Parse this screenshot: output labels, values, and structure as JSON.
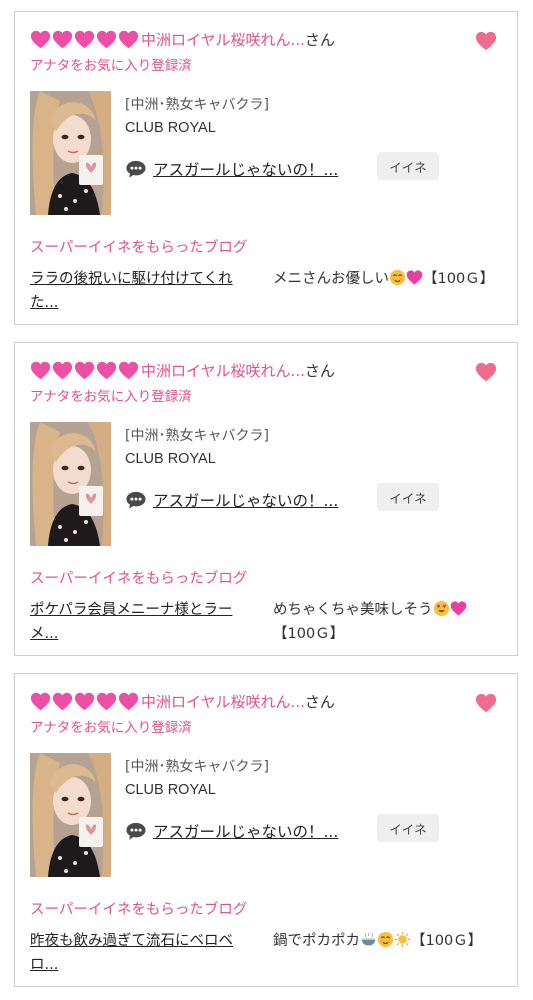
{
  "colors": {
    "accent": "#e2518f",
    "heart": "#ee4fa6",
    "fav_heart": "#f06b8e"
  },
  "cards": [
    {
      "hearts": 5,
      "shop_name": "中洲ロイヤル桜咲れん...",
      "san": "さん",
      "registered": "アナタをお気に入り登録済",
      "category": "[中洲･熟女キャバクラ]",
      "club": "CLUB ROYAL",
      "blog_title": "アスガールじゃないの！...",
      "iine": "イイネ",
      "super_label": "スーパーイイネをもらったブログ",
      "super_link": "ララの後祝いに駆け付けてくれた...",
      "super_comment": "メニさんお優しい",
      "super_comment_emojis": [
        "relieved-emoji",
        "pink-heart-emoji"
      ],
      "super_comment_tail": "【100Ｇ】"
    },
    {
      "hearts": 5,
      "shop_name": "中洲ロイヤル桜咲れん...",
      "san": "さん",
      "registered": "アナタをお気に入り登録済",
      "category": "[中洲･熟女キャバクラ]",
      "club": "CLUB ROYAL",
      "blog_title": "アスガールじゃないの！...",
      "iine": "イイネ",
      "super_label": "スーパーイイネをもらったブログ",
      "super_link": "ポケパラ会員メニーナ様とラーメ...",
      "super_comment": "めちゃくちゃ美味しそう",
      "super_comment_emojis": [
        "heart-eyes-emoji",
        "pink-heart-emoji"
      ],
      "super_comment_tail": "【100Ｇ】"
    },
    {
      "hearts": 5,
      "shop_name": "中洲ロイヤル桜咲れん...",
      "san": "さん",
      "registered": "アナタをお気に入り登録済",
      "category": "[中洲･熟女キャバクラ]",
      "club": "CLUB ROYAL",
      "blog_title": "アスガールじゃないの！...",
      "iine": "イイネ",
      "super_label": "スーパーイイネをもらったブログ",
      "super_link": "昨夜も飲み過ぎて流石にベロベロ...",
      "super_comment": "鍋でポカポカ",
      "super_comment_emojis": [
        "hot-bowl-emoji",
        "relieved-emoji",
        "sun-emoji"
      ],
      "super_comment_tail": "【100Ｇ】"
    }
  ]
}
